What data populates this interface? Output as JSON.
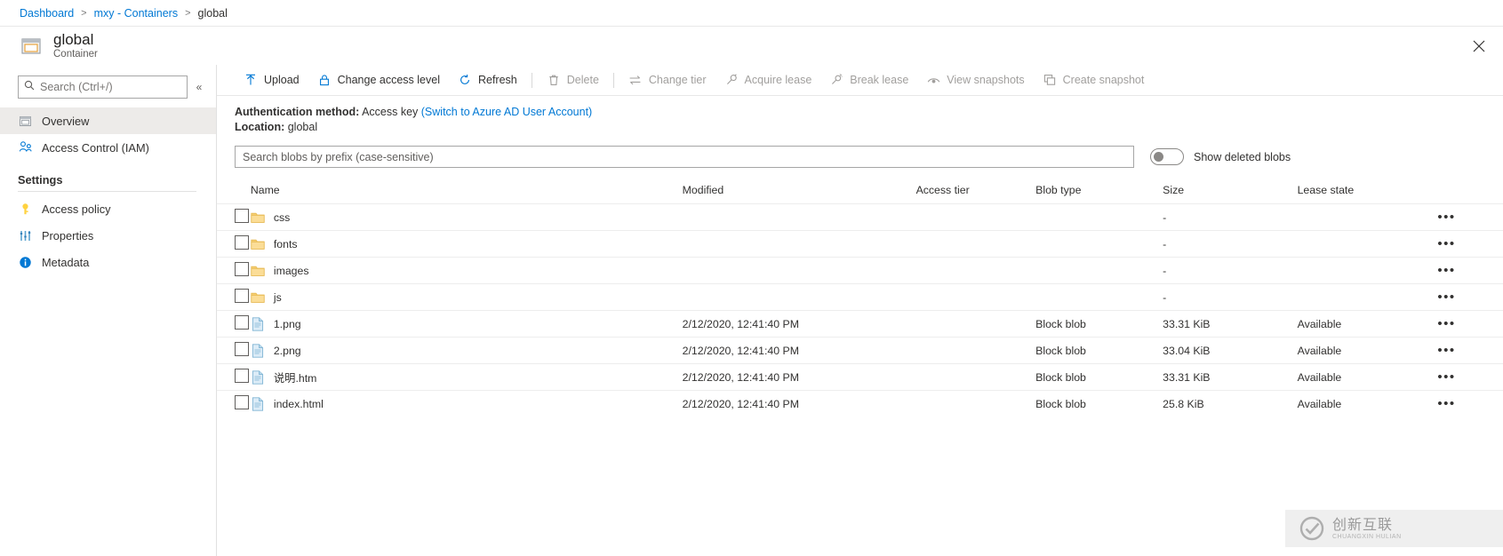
{
  "breadcrumb": {
    "items": [
      {
        "label": "Dashboard",
        "link": true
      },
      {
        "label": "mxy - Containers",
        "link": true
      },
      {
        "label": "global",
        "link": false
      }
    ],
    "separator": ">"
  },
  "header": {
    "title": "global",
    "subtitle": "Container",
    "close_icon": "close-icon"
  },
  "sidebar": {
    "search_placeholder": "Search (Ctrl+/)",
    "collapse_icon": "chevron-double-left-icon",
    "items": [
      {
        "label": "Overview",
        "icon": "container-icon",
        "selected": true
      },
      {
        "label": "Access Control (IAM)",
        "icon": "people-icon",
        "selected": false
      }
    ],
    "group_label": "Settings",
    "settings_items": [
      {
        "label": "Access policy",
        "icon": "key-icon"
      },
      {
        "label": "Properties",
        "icon": "sliders-icon"
      },
      {
        "label": "Metadata",
        "icon": "info-icon"
      }
    ]
  },
  "toolbar": {
    "items": [
      {
        "label": "Upload",
        "icon": "upload-icon",
        "disabled": false
      },
      {
        "label": "Change access level",
        "icon": "lock-icon",
        "disabled": false
      },
      {
        "label": "Refresh",
        "icon": "refresh-icon",
        "disabled": false
      },
      {
        "label": "Delete",
        "icon": "trash-icon",
        "disabled": true
      },
      {
        "label": "Change tier",
        "icon": "swap-icon",
        "disabled": true
      },
      {
        "label": "Acquire lease",
        "icon": "plug-icon",
        "disabled": true
      },
      {
        "label": "Break lease",
        "icon": "broken-plug-icon",
        "disabled": true
      },
      {
        "label": "View snapshots",
        "icon": "eye-icon",
        "disabled": true
      },
      {
        "label": "Create snapshot",
        "icon": "copy-icon",
        "disabled": true
      }
    ]
  },
  "info": {
    "auth_label": "Authentication method:",
    "auth_value": "Access key",
    "auth_switch_link": "(Switch to Azure AD User Account)",
    "location_label": "Location:",
    "location_value": "global"
  },
  "filter": {
    "prefix_placeholder": "Search blobs by prefix (case-sensitive)",
    "prefix_value": "",
    "toggle_state": "off",
    "toggle_label": "Show deleted blobs"
  },
  "table": {
    "columns": [
      "Name",
      "Modified",
      "Access tier",
      "Blob type",
      "Size",
      "Lease state"
    ],
    "rows": [
      {
        "name": "css",
        "icon": "folder-icon",
        "modified": "",
        "tier": "",
        "type": "",
        "size": "-",
        "lease": "",
        "menu": "•••"
      },
      {
        "name": "fonts",
        "icon": "folder-icon",
        "modified": "",
        "tier": "",
        "type": "",
        "size": "-",
        "lease": "",
        "menu": "•••"
      },
      {
        "name": "images",
        "icon": "folder-icon",
        "modified": "",
        "tier": "",
        "type": "",
        "size": "-",
        "lease": "",
        "menu": "•••"
      },
      {
        "name": "js",
        "icon": "folder-icon",
        "modified": "",
        "tier": "",
        "type": "",
        "size": "-",
        "lease": "",
        "menu": "•••"
      },
      {
        "name": "1.png",
        "icon": "document-icon",
        "modified": "2/12/2020, 12:41:40 PM",
        "tier": "",
        "type": "Block blob",
        "size": "33.31 KiB",
        "lease": "Available",
        "menu": "•••"
      },
      {
        "name": "2.png",
        "icon": "document-icon",
        "modified": "2/12/2020, 12:41:40 PM",
        "tier": "",
        "type": "Block blob",
        "size": "33.04 KiB",
        "lease": "Available",
        "menu": "•••"
      },
      {
        "name": "说明.htm",
        "icon": "document-icon",
        "modified": "2/12/2020, 12:41:40 PM",
        "tier": "",
        "type": "Block blob",
        "size": "33.31 KiB",
        "lease": "Available",
        "menu": "•••"
      },
      {
        "name": "index.html",
        "icon": "document-icon",
        "modified": "2/12/2020, 12:41:40 PM",
        "tier": "",
        "type": "Block blob",
        "size": "25.8 KiB",
        "lease": "Available",
        "menu": "•••"
      }
    ]
  },
  "watermark": {
    "main": "创新互联",
    "sub": "CHUANGXIN HULIAN"
  },
  "colors": {
    "accent": "#0078d4",
    "folder": "#f2c14e",
    "selected_bg": "#edebe9",
    "disabled_text": "#a19f9d"
  }
}
